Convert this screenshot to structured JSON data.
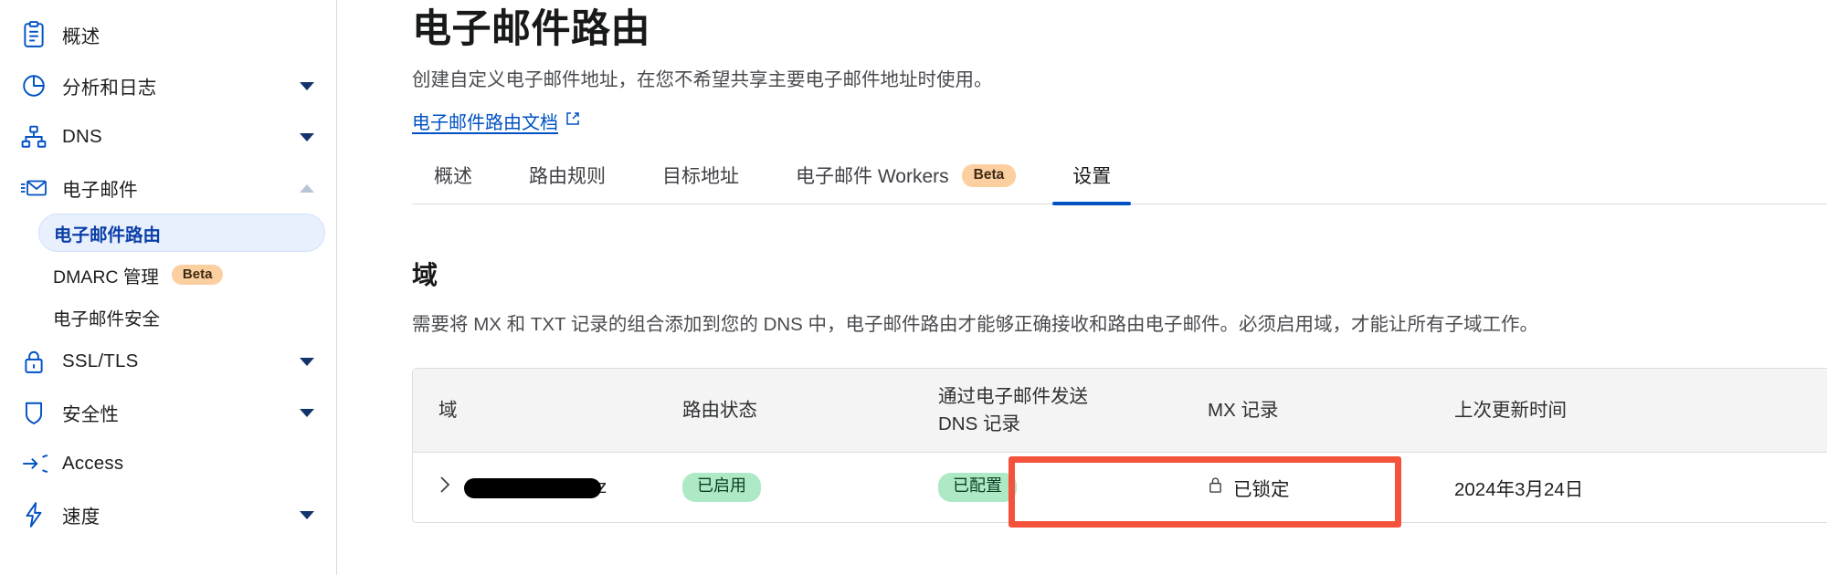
{
  "sidebar": {
    "items": [
      {
        "label": "概述",
        "icon": "clipboard-icon",
        "has_chevron": false,
        "state": ""
      },
      {
        "label": "分析和日志",
        "icon": "analytics-pie-icon",
        "has_chevron": true,
        "state": "collapsed"
      },
      {
        "label": "DNS",
        "icon": "dns-sitemap-icon",
        "has_chevron": true,
        "state": "collapsed"
      },
      {
        "label": "电子邮件",
        "icon": "envelope-icon",
        "has_chevron": true,
        "state": "expanded"
      },
      {
        "label": "SSL/TLS",
        "icon": "lock-icon",
        "has_chevron": true,
        "state": "collapsed"
      },
      {
        "label": "安全性",
        "icon": "shield-icon",
        "has_chevron": true,
        "state": "collapsed"
      },
      {
        "label": "Access",
        "icon": "access-arrow-icon",
        "has_chevron": false,
        "state": ""
      },
      {
        "label": "速度",
        "icon": "bolt-icon",
        "has_chevron": true,
        "state": "collapsed"
      }
    ],
    "email_subitems": [
      {
        "label": "电子邮件路由",
        "active": true,
        "badge": ""
      },
      {
        "label": "DMARC 管理",
        "active": false,
        "badge": "Beta"
      },
      {
        "label": "电子邮件安全",
        "active": false,
        "badge": ""
      }
    ]
  },
  "header": {
    "title": "电子邮件路由",
    "subtitle": "创建自定义电子邮件地址，在您不希望共享主要电子邮件地址时使用。",
    "doc_link": "电子邮件路由文档"
  },
  "tabs": [
    {
      "label": "概述",
      "badge": "",
      "active": false
    },
    {
      "label": "路由规则",
      "badge": "",
      "active": false
    },
    {
      "label": "目标地址",
      "badge": "",
      "active": false
    },
    {
      "label": "电子邮件 Workers",
      "badge": "Beta",
      "active": false
    },
    {
      "label": "设置",
      "badge": "",
      "active": true
    }
  ],
  "section": {
    "title": "域",
    "description": "需要将 MX 和 TXT 记录的组合添加到您的 DNS 中，电子邮件路由才能够正确接收和路由电子邮件。必须启用域，才能让所有子域工作。"
  },
  "table": {
    "columns": [
      {
        "key": "domain",
        "label": "域"
      },
      {
        "key": "status",
        "label": "路由状态"
      },
      {
        "key": "dns",
        "label_line1": "通过电子邮件发送",
        "label_line2": "DNS 记录"
      },
      {
        "key": "mx",
        "label": "MX 记录"
      },
      {
        "key": "updated",
        "label": "上次更新时间"
      }
    ],
    "rows": [
      {
        "domain": "z",
        "domain_redacted": true,
        "status": "已启用",
        "dns": "已配置",
        "mx": "已锁定",
        "updated": "2024年3月24日",
        "more": "•••"
      }
    ]
  },
  "annotation": {
    "color": "#f4523b",
    "target": "路由状态 与 通过电子邮件发送 DNS 记录 列的状态徽章"
  },
  "colors": {
    "accent_blue": "#0051c3",
    "badge_green_bg": "#aee9c5",
    "badge_green_text": "#0b3d22",
    "badge_beta_bg": "#fbcfa0",
    "annotation_red": "#f4523b",
    "sidebar_active_bg": "#e8f0fd"
  }
}
